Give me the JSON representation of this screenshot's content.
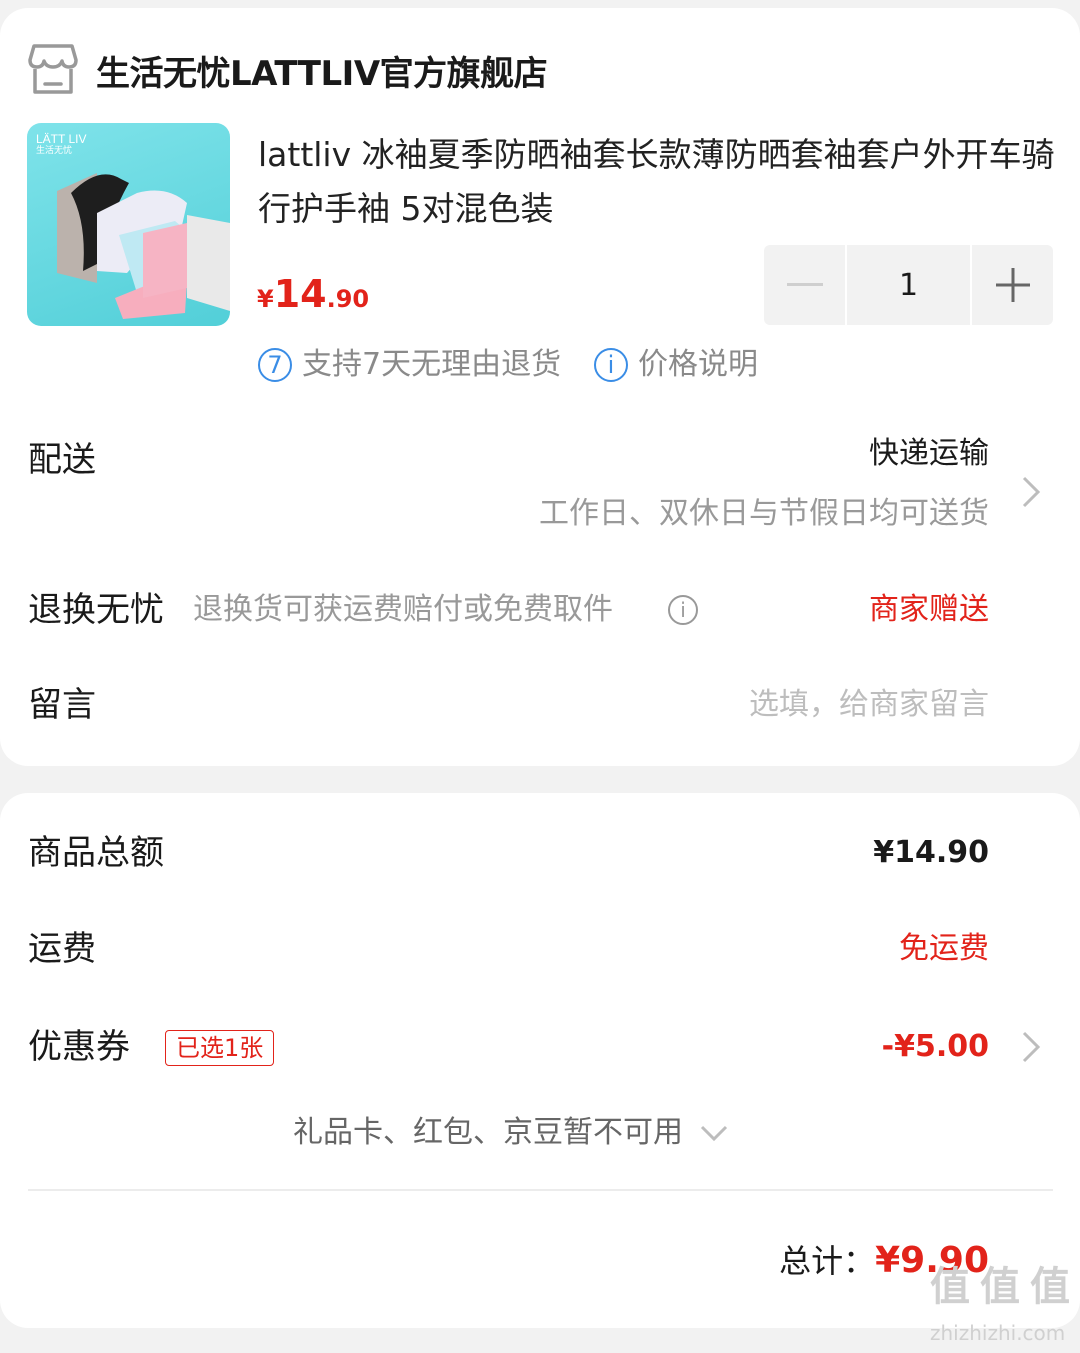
{
  "shop": {
    "name": "生活无忧LATTLIV官方旗舰店",
    "icon": "store-icon"
  },
  "product": {
    "image_brand": "LÄTT LIV",
    "image_brand_cn": "生活无忧",
    "title": "lattliv 冰袖夏季防晒袖套长款薄防晒套袖套户外开车骑行护手袖 5对混色装",
    "price_symbol": "¥",
    "price_integer": "14",
    "price_decimal": ".90",
    "quantity": "1",
    "services": [
      {
        "icon_text": "7",
        "icon": "seven-day-return-icon",
        "label": "支持7天无理由退货"
      },
      {
        "icon_text": "i",
        "icon": "info-icon",
        "label": "价格说明"
      }
    ]
  },
  "delivery": {
    "label": "配送",
    "method": "快递运输",
    "note": "工作日、双休日与节假日均可送货"
  },
  "return_worry_free": {
    "label": "退换无忧",
    "description": "退换货可获运费赔付或免费取件",
    "value": "商家赠送"
  },
  "message": {
    "label": "留言",
    "placeholder": "选填，给商家留言"
  },
  "summary": {
    "goods_total_label": "商品总额",
    "goods_total_value": "¥14.90",
    "shipping_label": "运费",
    "shipping_value": "免运费",
    "coupon_label": "优惠券",
    "coupon_badge": "已选1张",
    "coupon_value": "-¥5.00",
    "unavailable_text": "礼品卡、红包、京豆暂不可用",
    "total_label": "总计：",
    "total_value": "¥9.90"
  },
  "watermark": {
    "logo": "值",
    "site": "zhizhizhi.com"
  },
  "colors": {
    "accent_red": "#e2231a",
    "link_blue": "#3a8de6",
    "background": "#f2f2f2"
  }
}
